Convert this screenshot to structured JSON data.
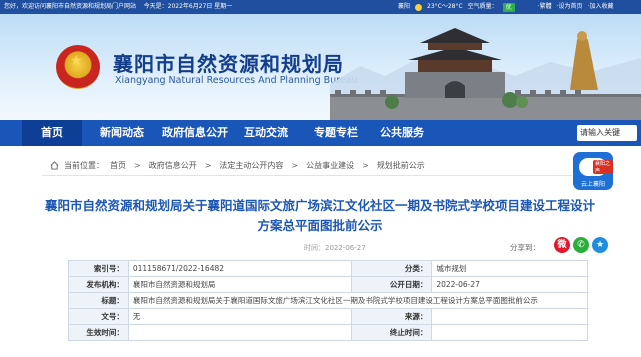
{
  "topbar": {
    "greeting": "您好，欢迎访问襄阳市自然资源和规划局门户网站",
    "date": "今天是：2022年6月27日 星期一",
    "city": "襄阳",
    "weather": "23°C～28°C",
    "aqi_label": "空气质量：",
    "aqi_value": "优",
    "links": [
      "·繁體",
      "·设为首页",
      "·加入收藏"
    ]
  },
  "header": {
    "title": "襄阳市自然资源和规划局",
    "subtitle": "Xiangyang Natural Resources And Planning Bureau"
  },
  "nav": {
    "items": [
      "首页",
      "新闻动态",
      "政府信息公开",
      "互动交流",
      "专题专栏",
      "公共服务"
    ],
    "search_placeholder": "请输入关键"
  },
  "breadcrumb": {
    "label": "当前位置：",
    "items": [
      "首页",
      "政府信息公开",
      "法定主动公开内容",
      "公益事业建设",
      "规划批前公示"
    ]
  },
  "app_badge": {
    "name": "襄阳之声",
    "caption": "云上襄阳"
  },
  "article": {
    "title": "襄阳市自然资源和规划局关于襄阳道国际文旅广场滨江文化社区一期及书院式学校项目建设工程设计方案总平面图批前公示",
    "time": "时间：2022-06-27",
    "share_label": "分享到："
  },
  "info": {
    "index_label": "索引号：",
    "index_value": "011158671/2022-16482",
    "category_label": "分类：",
    "category_value": "城市规划",
    "publisher_label": "发布机构：",
    "publisher_value": "襄阳市自然资源和规划局",
    "pubdate_label": "公开日期：",
    "pubdate_value": "2022-06-27",
    "title_label": "标题：",
    "title_value": "襄阳市自然资源和规划局关于襄阳道国际文旅广场滨江文化社区一期及书院式学校项目建设工程设计方案总平面图批前公示",
    "docno_label": "文号：",
    "docno_value": "无",
    "source_label": "来源：",
    "source_value": "",
    "effective_label": "生效时间：",
    "effective_value": "",
    "expire_label": "终止时间：",
    "expire_value": ""
  },
  "colors": {
    "brand_blue": "#1a56b8",
    "title_blue": "#1d57b3",
    "topbar": "#1f4f9e"
  }
}
